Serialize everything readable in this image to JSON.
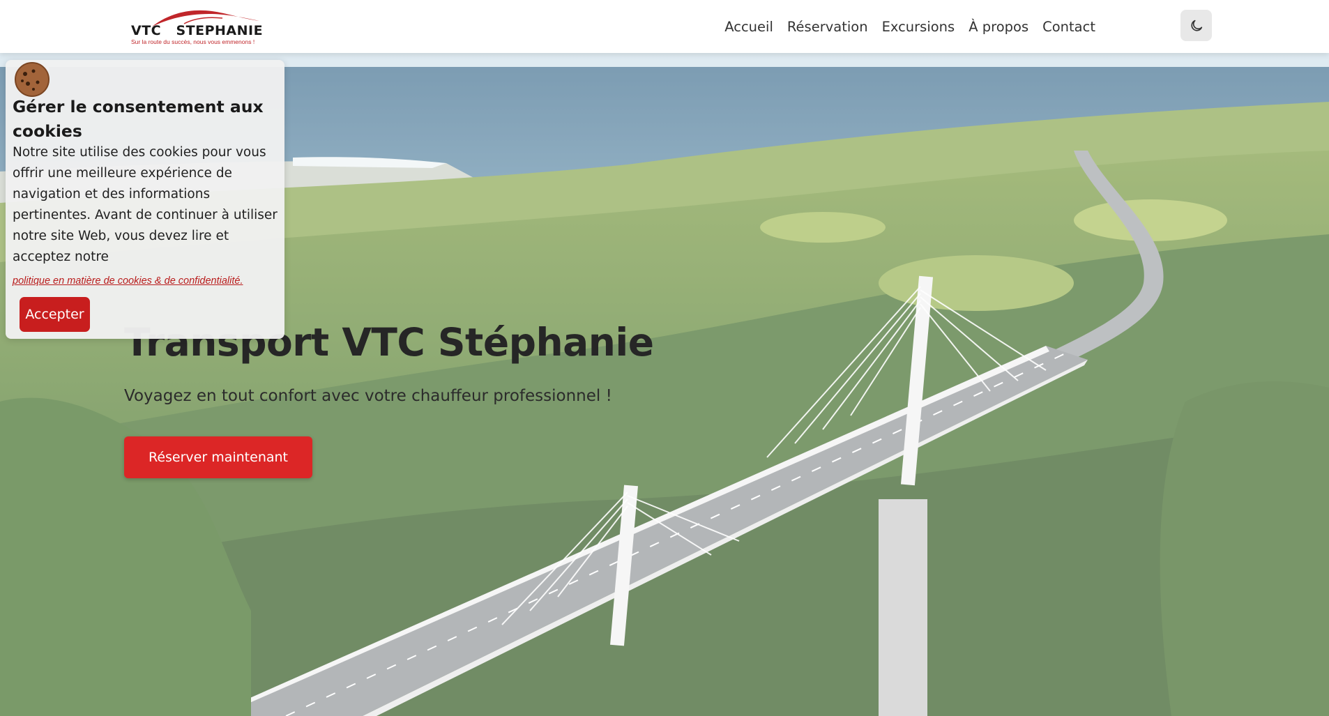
{
  "brand": {
    "name": "VTC   STEPHANIE",
    "tagline": "Sur la route du succès, nous vous emmenons !",
    "accent_color": "#dc2626"
  },
  "nav": {
    "items": [
      {
        "label": "Accueil"
      },
      {
        "label": "Réservation"
      },
      {
        "label": "Excursions"
      },
      {
        "label": "À propos"
      },
      {
        "label": "Contact"
      }
    ],
    "theme_toggle_icon": "moon-icon"
  },
  "hero": {
    "title": "Transport VTC Stéphanie",
    "subtitle": "Voyagez en tout confort avec votre chauffeur professionnel !",
    "cta_label": "Réserver maintenant",
    "background": "viaduct-landscape-photo"
  },
  "cookie_banner": {
    "icon": "cookie-icon",
    "title": "Gérer le consentement aux cookies",
    "text": "Notre site utilise des cookies pour vous offrir une meilleure expérience de navigation et des informations pertinentes. Avant de continuer à utiliser notre site Web, vous devez lire et acceptez notre",
    "link_text": "politique en matière de cookies & de confidentialité.",
    "accept_label": "Accepter"
  }
}
